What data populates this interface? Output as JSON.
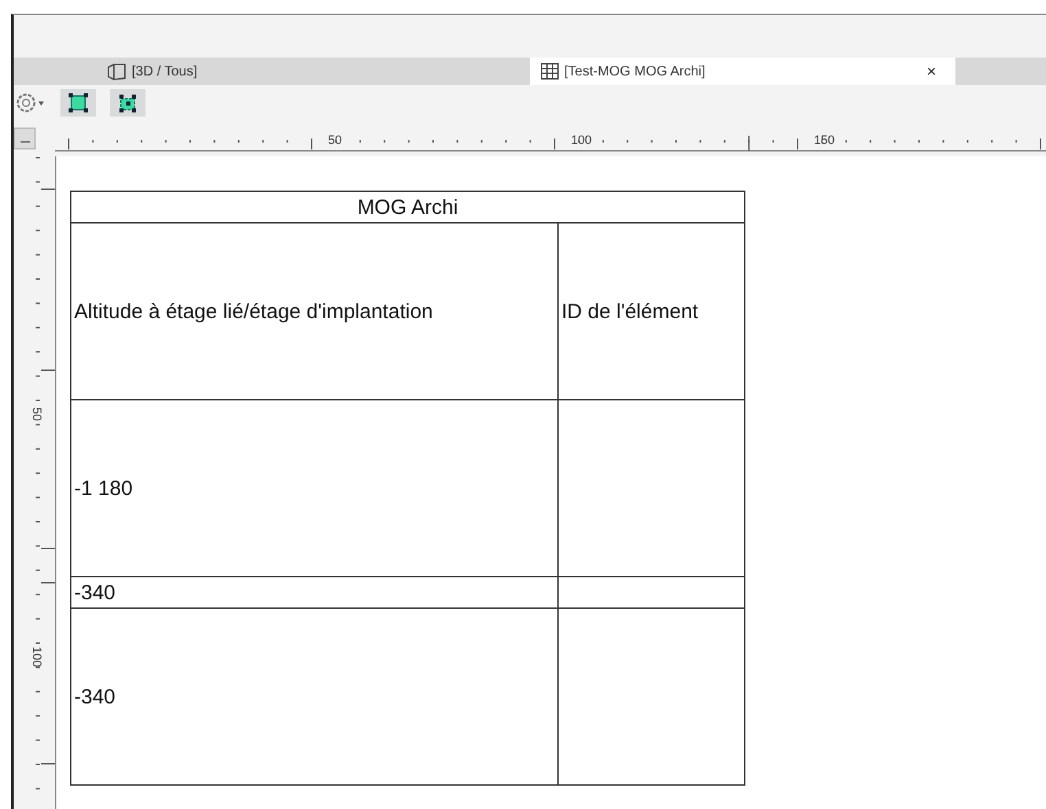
{
  "tabs": [
    {
      "label": "[3D / Tous]",
      "kind": "view3d",
      "selected": false
    },
    {
      "label": "[Test-MOG MOG Archi]",
      "kind": "table",
      "selected": true,
      "close": "×"
    }
  ],
  "ruler": {
    "horizontal_labels": [
      "50",
      "100",
      "150"
    ],
    "vertical_labels": [
      "50",
      "100"
    ]
  },
  "table": {
    "title": "MOG Archi",
    "columns": [
      "Altitude à étage lié/étage d'implantation",
      "ID de l'élément"
    ],
    "rows": [
      {
        "kind": "tall",
        "column_1": "-1 180"
      },
      {
        "kind": "short",
        "column_1": "-340"
      },
      {
        "kind": "tall",
        "column_1": "-340"
      }
    ]
  }
}
